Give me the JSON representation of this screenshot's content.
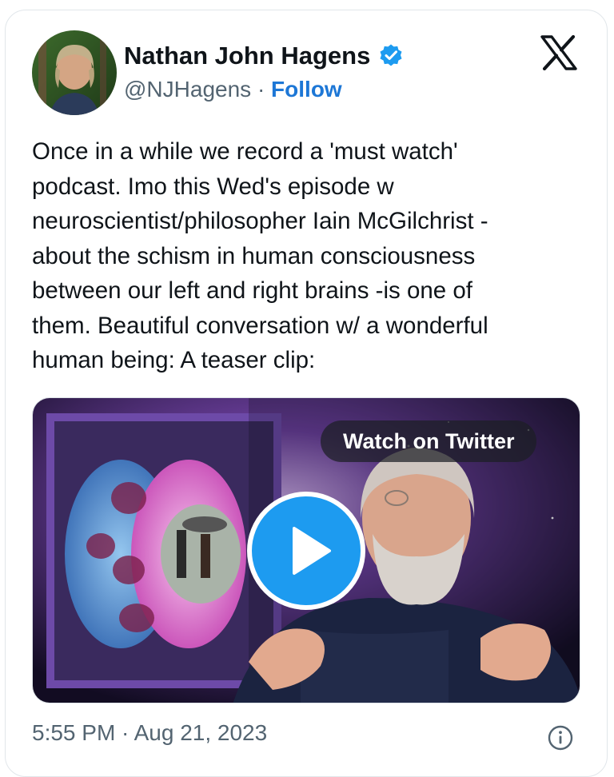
{
  "author": {
    "name": "Nathan John Hagens",
    "handle": "@NJHagens",
    "separator": "·",
    "follow_label": "Follow",
    "verified_icon": "verified-badge-icon",
    "accent_color": "#1d77d6"
  },
  "platform_logo": "x-logo-icon",
  "tweet": {
    "text": "Once in a while we record a 'must watch'\npodcast. Imo this Wed's episode w\nneuroscientist/philosopher Iain McGilchrist -\nabout the schism in human consciousness\nbetween our left and right brains -is one of\nthem. Beautiful conversation w/ a wonderful\nhuman being:  A teaser clip:"
  },
  "media": {
    "watch_label": "Watch on Twitter",
    "play_icon": "play-icon",
    "play_color": "#1d9bf0"
  },
  "footer": {
    "timestamp": "5:55 PM · Aug 21, 2023",
    "info_icon": "info-icon"
  }
}
